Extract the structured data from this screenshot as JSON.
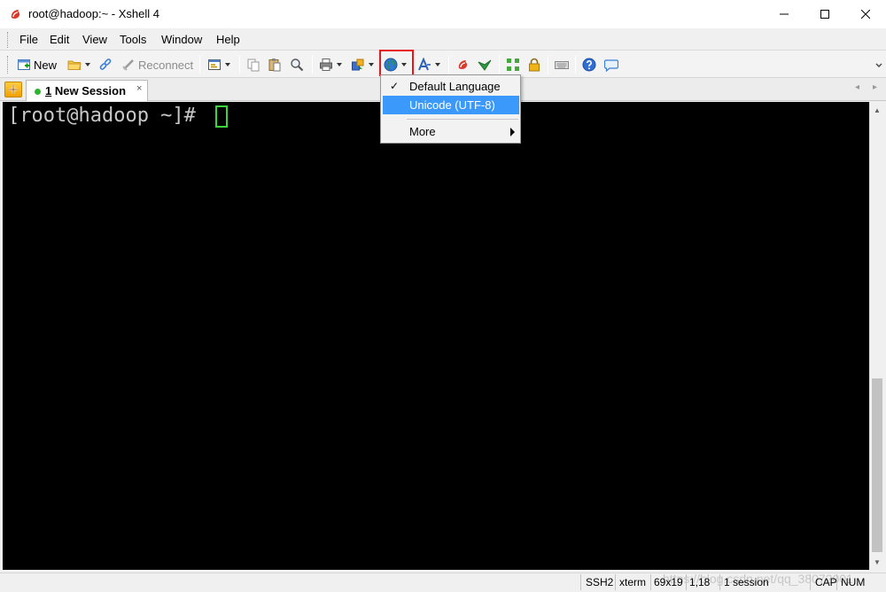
{
  "window": {
    "title": "root@hadoop:~ - Xshell 4",
    "minimize": "—",
    "maximize": "☐",
    "close": "✕"
  },
  "menubar": {
    "items": [
      "File",
      "Edit",
      "View",
      "Tools",
      "Window",
      "Help"
    ]
  },
  "toolbar": {
    "new_label": "New",
    "reconnect_label": "Reconnect",
    "icons": [
      "new-session-icon",
      "open-folder-icon",
      "link-icon",
      "reconnect-icon",
      "properties-icon",
      "copy-icon",
      "paste-icon",
      "find-icon",
      "print-icon",
      "transfer-icon",
      "encoding-globe-icon",
      "font-icon",
      "xftp-icon",
      "xagent-icon",
      "fullscreen-icon",
      "lock-icon",
      "keyboard-icon",
      "help-icon",
      "chat-icon"
    ]
  },
  "tabs": {
    "add": "+",
    "items": [
      {
        "number": "1",
        "label": " New Session",
        "close": "×",
        "status": "connected"
      }
    ],
    "nav_left": "◂",
    "nav_right": "▸"
  },
  "terminal": {
    "prompt": "[root@hadoop ~]# "
  },
  "scrollbar": {
    "up": "▲",
    "down": "▼"
  },
  "encoding_menu": {
    "items": [
      {
        "label": "Default Language",
        "checked": true
      },
      {
        "label": "Unicode (UTF-8)",
        "highlighted": true
      },
      {
        "label": "More",
        "submenu": true
      }
    ],
    "check": "✓"
  },
  "statusbar": {
    "protocol": "SSH2",
    "term": "xterm",
    "size": "69x19",
    "cursor": "1,18",
    "sessions": "1 session",
    "cap": "CAP",
    "num": "NUM"
  },
  "watermark": "https://blog.csdn.net/qq_38072001",
  "colors": {
    "highlight": "#3b99fc",
    "callout": "#e8161b",
    "cursor": "#3cd63c"
  }
}
